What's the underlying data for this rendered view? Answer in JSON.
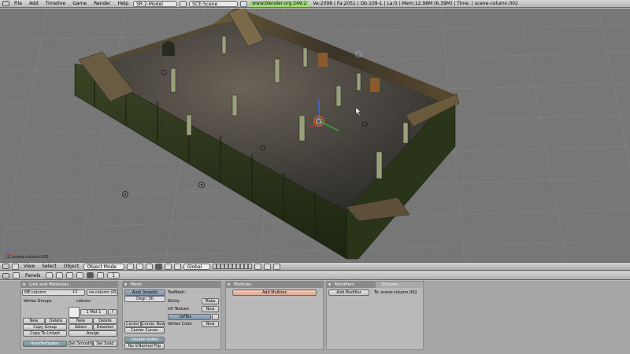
{
  "top_menu": {
    "items": [
      "File",
      "Add",
      "Timeline",
      "Game",
      "Render",
      "Help"
    ],
    "screen": "SR:2-Model",
    "scene": "SCE:Scene",
    "version": "www.blender.org 249.2",
    "stats": "Ve:2098 | Fa:2051 | Ob:109-1 | La:0 | Mem:12.98M (6.39M) | Time: | scene-column.002"
  },
  "viewport": {
    "active_object_label": "(1) scene-column.002"
  },
  "view_header": {
    "menus": [
      "View",
      "Select",
      "Object"
    ],
    "mode": "Object Mode",
    "orientation": "Global"
  },
  "buttons_header": {
    "label": "Panels",
    "frame": "1"
  },
  "link_materials": {
    "title": "Link and Materials",
    "mesh_name": "ME:column",
    "users": "12",
    "ob_name": "ne-column.002",
    "vertex_groups": "Vertex Groups",
    "material_label": "column",
    "mat_index": "1 Mat 1",
    "question": "?",
    "new": "New",
    "delete": "Delete",
    "copy_group": "Copy Group",
    "copy_to_linked": "Copy To Linked",
    "new2": "New",
    "delete2": "Delete",
    "select": "Select",
    "deselect": "Deselect",
    "assign": "Assign",
    "autotexspace": "AutoTexSpace",
    "set_smooth": "Set Smooth",
    "set_solid": "Set Solid"
  },
  "mesh": {
    "title": "Mesh",
    "auto_smooth": "Auto Smooth",
    "degr": "Degr: 30",
    "texmesh": "TexMesh:",
    "sticky": "Sticky",
    "make": "Make",
    "uv_texture": "UV Texture",
    "new": "New",
    "uvtex": "UVTex",
    "vertex_color": "Vertex Color",
    "new_vc": "New",
    "center": "Center",
    "center_new": "Center New",
    "center_cursor": "Center Cursor",
    "double_sided": "Double Sided",
    "no_v_normal_flip": "No V.Normal Flip"
  },
  "multires": {
    "title": "Multires",
    "add_multires": "Add Multires"
  },
  "modifiers": {
    "tab_modifiers": "Modifiers",
    "tab_shapes": "Shapes",
    "add_modifier": "Add Modifier",
    "to_label": "To: scene-column.002"
  },
  "colors": {
    "viewport_bg": "#777777",
    "grid": "#8a8a8a",
    "floor": "#3d3d3d",
    "wall": "#2f3a1e",
    "highlight": "#9ed86f"
  }
}
